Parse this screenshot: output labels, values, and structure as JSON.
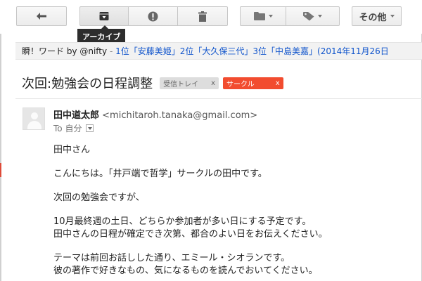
{
  "toolbar": {
    "back_icon": "reply-arrow-icon",
    "archive_icon": "archive-icon",
    "spam_icon": "report-spam-icon",
    "delete_icon": "trash-icon",
    "folder_icon": "folder-icon",
    "label_icon": "label-tag-icon",
    "more_label": "その他",
    "tooltip": "アーカイブ"
  },
  "webclip": {
    "source": "瞬！ワード by @nifty",
    "separator": "-",
    "text": "1位「安藤美姫」2位「大久保三代」3位「中島美嘉」(2014年11月26日"
  },
  "subject": {
    "text": "次回:勉強会の日程調整",
    "labels": [
      {
        "name": "受信トレイ",
        "remove": "x"
      },
      {
        "name": "サークル",
        "remove": "x"
      }
    ]
  },
  "sender": {
    "name": "田中道太郎",
    "email": "<michitaroh.tanaka@gmail.com>",
    "to": "To 自分"
  },
  "body": {
    "lines": [
      "田中さん",
      "",
      "こんにちは。「井戸端で哲学」サークルの田中です。",
      "",
      "次回の勉強会ですが、",
      "",
      "10月最終週の土日、どちらか参加者が多い日にする予定です。",
      "田中さんの日程が確定でき次第、都合のよい日をお伝えください。",
      "",
      "テーマは前回お話しした通り、エミール・シオランです。",
      "彼の著作で好きなもの、気になるものを読んでおいてください。"
    ]
  },
  "colors": {
    "label_circle": "#f24c2f",
    "link": "#1155cc",
    "tooltip_bg": "#2d2d2d"
  }
}
